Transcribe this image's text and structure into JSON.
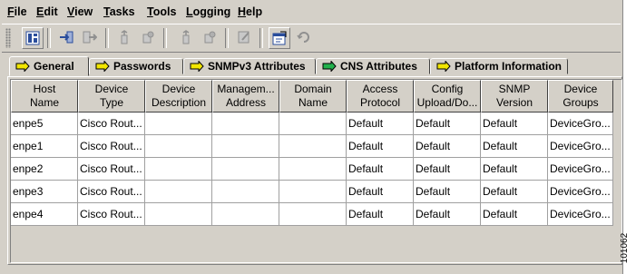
{
  "menu": [
    "File",
    "Edit",
    "View",
    "Tasks",
    "Tools",
    "Logging",
    "Help"
  ],
  "toolbar": {
    "buttons": [
      {
        "name": "device-view-icon",
        "enabled": true
      },
      {
        "name": "import-icon",
        "enabled": true
      },
      {
        "name": "export-icon",
        "enabled": false
      },
      {
        "name": "add-device-icon",
        "enabled": false
      },
      {
        "name": "delete-device-icon",
        "enabled": false
      },
      {
        "name": "add-group-icon",
        "enabled": false
      },
      {
        "name": "delete-group-icon",
        "enabled": false
      },
      {
        "name": "edit-icon",
        "enabled": false
      },
      {
        "name": "properties-icon",
        "enabled": true
      },
      {
        "name": "refresh-icon",
        "enabled": false
      }
    ]
  },
  "tabs": [
    {
      "label": "General",
      "active": true
    },
    {
      "label": "Passwords",
      "active": false
    },
    {
      "label": "SNMPv3 Attributes",
      "active": false
    },
    {
      "label": "CNS Attributes",
      "active": false
    },
    {
      "label": "Platform Information",
      "active": false
    }
  ],
  "table": {
    "headers": [
      "Host\nName",
      "Device\nType",
      "Device\nDescription",
      "Managem...\nAddress",
      "Domain\nName",
      "Access\nProtocol",
      "Config\nUpload/Do...",
      "SNMP\nVersion",
      "Device\nGroups"
    ],
    "rows": [
      [
        "enpe5",
        "Cisco Rout...",
        "",
        "",
        "",
        "Default",
        "Default",
        "Default",
        "DeviceGro..."
      ],
      [
        "enpe1",
        "Cisco Rout...",
        "",
        "",
        "",
        "Default",
        "Default",
        "Default",
        "DeviceGro..."
      ],
      [
        "enpe2",
        "Cisco Rout...",
        "",
        "",
        "",
        "Default",
        "Default",
        "Default",
        "DeviceGro..."
      ],
      [
        "enpe3",
        "Cisco Rout...",
        "",
        "",
        "",
        "Default",
        "Default",
        "Default",
        "DeviceGro..."
      ],
      [
        "enpe4",
        "Cisco Rout...",
        "",
        "",
        "",
        "Default",
        "Default",
        "Default",
        "DeviceGro..."
      ]
    ]
  },
  "figure_number": "101062",
  "colors": {
    "tab_icon_fill": "#f2e600",
    "cns_icon_fill": "#22b14c",
    "toolbar_icon": "#2a4d9c"
  }
}
